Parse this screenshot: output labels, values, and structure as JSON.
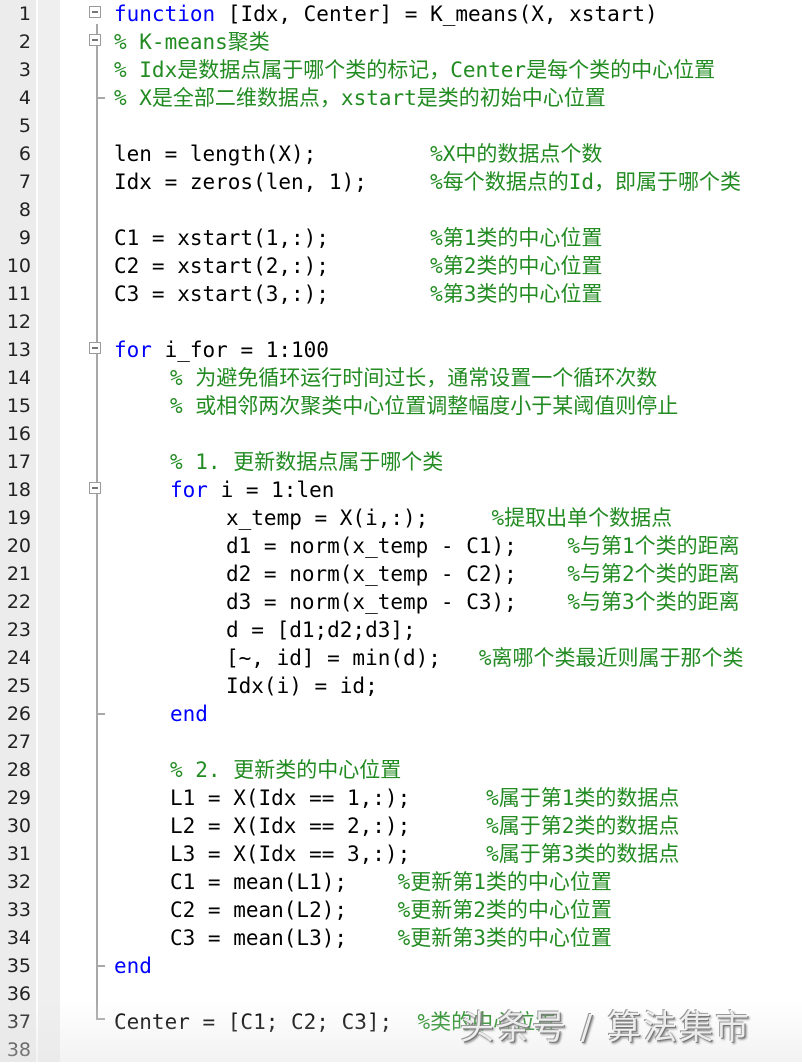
{
  "editor": {
    "language": "MATLAB",
    "lines": [
      {
        "n": "1",
        "indent": 0,
        "code": "",
        "kw": "function",
        "rest": " [Idx, Center] = K_means(X, xstart)",
        "comment": "",
        "pad": ""
      },
      {
        "n": "2",
        "indent": 0,
        "code": "",
        "kw": "",
        "rest": "",
        "comment": "% K-means聚类",
        "pad": ""
      },
      {
        "n": "3",
        "indent": 0,
        "code": "",
        "kw": "",
        "rest": "",
        "comment": "% Idx是数据点属于哪个类的标记，Center是每个类的中心位置",
        "pad": ""
      },
      {
        "n": "4",
        "indent": 0,
        "code": "",
        "kw": "",
        "rest": "",
        "comment": "% X是全部二维数据点，xstart是类的初始中心位置",
        "pad": ""
      },
      {
        "n": "5",
        "indent": 0,
        "code": "",
        "kw": "",
        "rest": "",
        "comment": "",
        "pad": ""
      },
      {
        "n": "6",
        "indent": 0,
        "code": "len = length(X);",
        "kw": "",
        "rest": "",
        "comment": "%X中的数据点个数",
        "pad": "         "
      },
      {
        "n": "7",
        "indent": 0,
        "code": "Idx = zeros(len, 1);",
        "kw": "",
        "rest": "",
        "comment": "%每个数据点的Id，即属于哪个类",
        "pad": "     "
      },
      {
        "n": "8",
        "indent": 0,
        "code": "",
        "kw": "",
        "rest": "",
        "comment": "",
        "pad": ""
      },
      {
        "n": "9",
        "indent": 0,
        "code": "C1 = xstart(1,:);",
        "kw": "",
        "rest": "",
        "comment": "%第1类的中心位置",
        "pad": "        "
      },
      {
        "n": "10",
        "indent": 0,
        "code": "C2 = xstart(2,:);",
        "kw": "",
        "rest": "",
        "comment": "%第2类的中心位置",
        "pad": "        "
      },
      {
        "n": "11",
        "indent": 0,
        "code": "C3 = xstart(3,:);",
        "kw": "",
        "rest": "",
        "comment": "%第3类的中心位置",
        "pad": "        "
      },
      {
        "n": "12",
        "indent": 0,
        "code": "",
        "kw": "",
        "rest": "",
        "comment": "",
        "pad": ""
      },
      {
        "n": "13",
        "indent": 0,
        "code": "",
        "kw": "for",
        "rest": " i_for = 1:100",
        "comment": "",
        "pad": ""
      },
      {
        "n": "14",
        "indent": 4,
        "code": "",
        "kw": "",
        "rest": "",
        "comment": "% 为避免循环运行时间过长，通常设置一个循环次数",
        "pad": ""
      },
      {
        "n": "15",
        "indent": 4,
        "code": "",
        "kw": "",
        "rest": "",
        "comment": "% 或相邻两次聚类中心位置调整幅度小于某阈值则停止",
        "pad": ""
      },
      {
        "n": "16",
        "indent": 0,
        "code": "",
        "kw": "",
        "rest": "",
        "comment": "",
        "pad": ""
      },
      {
        "n": "17",
        "indent": 4,
        "code": "",
        "kw": "",
        "rest": "",
        "comment": "% 1. 更新数据点属于哪个类",
        "pad": ""
      },
      {
        "n": "18",
        "indent": 4,
        "code": "",
        "kw": "for",
        "rest": " i = 1:len",
        "comment": "",
        "pad": ""
      },
      {
        "n": "19",
        "indent": 8,
        "code": "x_temp = X(i,:);",
        "kw": "",
        "rest": "",
        "comment": "%提取出单个数据点",
        "pad": "     "
      },
      {
        "n": "20",
        "indent": 8,
        "code": "d1 = norm(x_temp - C1);",
        "kw": "",
        "rest": "",
        "comment": "%与第1个类的距离",
        "pad": "    "
      },
      {
        "n": "21",
        "indent": 8,
        "code": "d2 = norm(x_temp - C2);",
        "kw": "",
        "rest": "",
        "comment": "%与第2个类的距离",
        "pad": "    "
      },
      {
        "n": "22",
        "indent": 8,
        "code": "d3 = norm(x_temp - C3);",
        "kw": "",
        "rest": "",
        "comment": "%与第3个类的距离",
        "pad": "    "
      },
      {
        "n": "23",
        "indent": 8,
        "code": "d = [d1;d2;d3];",
        "kw": "",
        "rest": "",
        "comment": "",
        "pad": ""
      },
      {
        "n": "24",
        "indent": 8,
        "code": "[~, id] = min(d);",
        "kw": "",
        "rest": "",
        "comment": "%离哪个类最近则属于那个类",
        "pad": "   "
      },
      {
        "n": "25",
        "indent": 8,
        "code": "Idx(i) = id;",
        "kw": "",
        "rest": "",
        "comment": "",
        "pad": ""
      },
      {
        "n": "26",
        "indent": 4,
        "code": "",
        "kw": "end",
        "rest": "",
        "comment": "",
        "pad": ""
      },
      {
        "n": "27",
        "indent": 0,
        "code": "",
        "kw": "",
        "rest": "",
        "comment": "",
        "pad": ""
      },
      {
        "n": "28",
        "indent": 4,
        "code": "",
        "kw": "",
        "rest": "",
        "comment": "% 2. 更新类的中心位置",
        "pad": ""
      },
      {
        "n": "29",
        "indent": 4,
        "code": "L1 = X(Idx == 1,:);",
        "kw": "",
        "rest": "",
        "comment": "%属于第1类的数据点",
        "pad": "      "
      },
      {
        "n": "30",
        "indent": 4,
        "code": "L2 = X(Idx == 2,:);",
        "kw": "",
        "rest": "",
        "comment": "%属于第2类的数据点",
        "pad": "      "
      },
      {
        "n": "31",
        "indent": 4,
        "code": "L3 = X(Idx == 3,:);",
        "kw": "",
        "rest": "",
        "comment": "%属于第3类的数据点",
        "pad": "      "
      },
      {
        "n": "32",
        "indent": 4,
        "code": "C1 = mean(L1);",
        "kw": "",
        "rest": "",
        "comment": "%更新第1类的中心位置",
        "pad": "    "
      },
      {
        "n": "33",
        "indent": 4,
        "code": "C2 = mean(L2);",
        "kw": "",
        "rest": "",
        "comment": "%更新第2类的中心位置",
        "pad": "    "
      },
      {
        "n": "34",
        "indent": 4,
        "code": "C3 = mean(L3);",
        "kw": "",
        "rest": "",
        "comment": "%更新第3类的中心位置",
        "pad": "    "
      },
      {
        "n": "35",
        "indent": 0,
        "code": "",
        "kw": "end",
        "rest": "",
        "comment": "",
        "pad": ""
      },
      {
        "n": "36",
        "indent": 0,
        "code": "",
        "kw": "",
        "rest": "",
        "comment": "",
        "pad": ""
      },
      {
        "n": "37",
        "indent": 0,
        "code": "Center = [C1; C2; C3];",
        "kw": "",
        "rest": "",
        "comment": "%类的中心位置",
        "pad": "  "
      },
      {
        "n": "38",
        "indent": 0,
        "code": "",
        "kw": "",
        "rest": "",
        "comment": "",
        "pad": ""
      }
    ]
  },
  "watermark": "头条号 / 算法集市",
  "colors": {
    "keyword": "#0000ff",
    "comment": "#228b22",
    "text": "#000000",
    "gutter": "#ececec"
  }
}
